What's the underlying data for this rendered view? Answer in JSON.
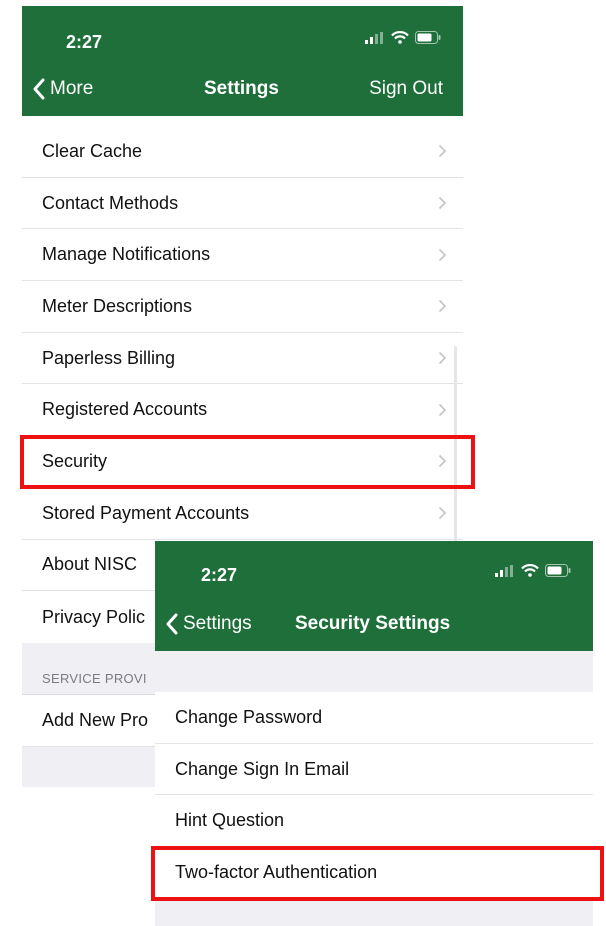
{
  "screen1": {
    "status_time": "2:27",
    "nav": {
      "back_label": "More",
      "title": "Settings",
      "right_label": "Sign Out"
    },
    "items": [
      {
        "label": "Clear Cache"
      },
      {
        "label": "Contact Methods"
      },
      {
        "label": "Manage Notifications"
      },
      {
        "label": "Meter Descriptions"
      },
      {
        "label": "Paperless Billing"
      },
      {
        "label": "Registered Accounts"
      },
      {
        "label": "Security"
      },
      {
        "label": "Stored Payment Accounts"
      },
      {
        "label": "About NISC"
      },
      {
        "label": "Privacy Polic"
      }
    ],
    "section_header": "SERVICE PROVI",
    "section_items": [
      {
        "label": "Add New Pro"
      }
    ]
  },
  "screen2": {
    "status_time": "2:27",
    "nav": {
      "back_label": "Settings",
      "title": "Security Settings"
    },
    "items": [
      {
        "label": "Change Password"
      },
      {
        "label": "Change Sign In Email"
      },
      {
        "label": "Hint Question"
      },
      {
        "label": "Two-factor Authentication"
      }
    ]
  },
  "colors": {
    "nav_green": "#1e6f3a",
    "highlight_red": "#ee1111",
    "grouped_bg": "#efeff4",
    "chevron": "#c6c6c8"
  },
  "icons": [
    "chevron-left-icon",
    "chevron-right-icon",
    "signal-icon",
    "wifi-icon",
    "battery-icon"
  ]
}
